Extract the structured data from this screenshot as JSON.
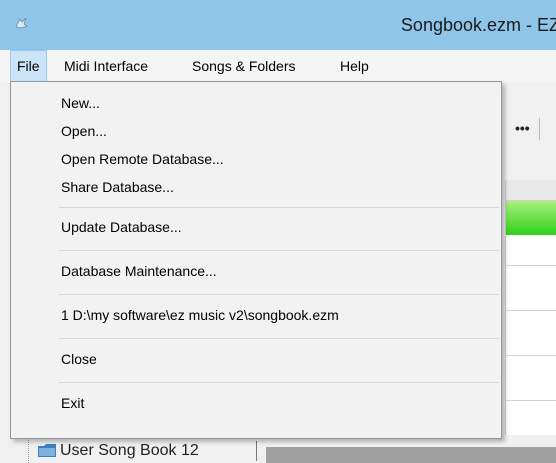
{
  "window": {
    "title": "Songbook.ezm - EZ"
  },
  "menubar": {
    "items": [
      {
        "label": "File"
      },
      {
        "label": "Midi Interface"
      },
      {
        "label": "Songs & Folders"
      },
      {
        "label": "Help"
      }
    ]
  },
  "file_menu": {
    "items": [
      {
        "label": "New..."
      },
      {
        "label": "Open..."
      },
      {
        "label": "Open Remote Database..."
      },
      {
        "label": "Share Database..."
      },
      {
        "label": "Update Database..."
      },
      {
        "label": "Database Maintenance..."
      },
      {
        "label": "1 D:\\my software\\ez music v2\\songbook.ezm"
      },
      {
        "label": "Close"
      },
      {
        "label": "Exit"
      }
    ]
  },
  "toolbar": {
    "dots_label": "•••"
  },
  "tree": {
    "row_label": "User Song Book 12"
  },
  "colors": {
    "titlebar": "#8fc5e8",
    "menu_active": "#cce4f7",
    "grid_highlight": "#3cd51e"
  },
  "icons": {
    "app": "app-icon",
    "folder": "folder-icon"
  }
}
